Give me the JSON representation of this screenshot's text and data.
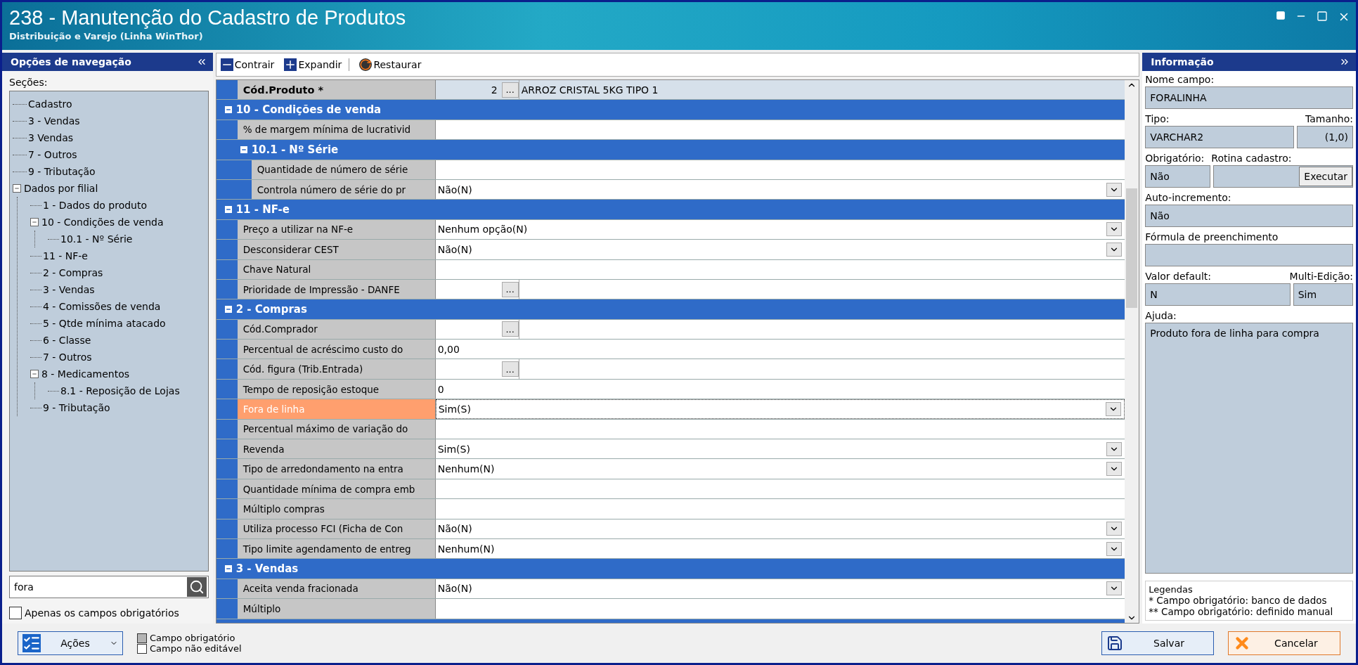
{
  "window": {
    "title": "238 - Manutenção do Cadastro de Produtos",
    "subtitle": "Distribuição e Varejo (Linha WinThor)"
  },
  "navigation": {
    "title": "Opções de navegação",
    "sections_label": "Seções:",
    "tree": [
      {
        "label": "Cadastro"
      },
      {
        "label": "3 - Vendas"
      },
      {
        "label": "3 Vendas"
      },
      {
        "label": "7 - Outros"
      },
      {
        "label": "9 - Tributação"
      },
      {
        "label": "Dados por filial",
        "expanded": true,
        "children": [
          {
            "label": "1 - Dados do produto"
          },
          {
            "label": "10 - Condições de venda",
            "expanded": true,
            "children": [
              {
                "label": "10.1 - Nº Série"
              }
            ]
          },
          {
            "label": "11 - NF-e"
          },
          {
            "label": "2 - Compras"
          },
          {
            "label": "3 - Vendas"
          },
          {
            "label": "4 - Comissões de venda"
          },
          {
            "label": "5 - Qtde mínima atacado"
          },
          {
            "label": "6 - Classe"
          },
          {
            "label": "7 - Outros"
          },
          {
            "label": "8 - Medicamentos",
            "expanded": true,
            "children": [
              {
                "label": "8.1 -  Reposição de Lojas"
              }
            ]
          },
          {
            "label": "9 - Tributação"
          }
        ]
      }
    ],
    "search_value": "fora",
    "required_only": {
      "label": "Apenas os campos obrigatórios",
      "checked": false
    }
  },
  "toolbar": [
    {
      "kind": "collapse",
      "label": "Contrair"
    },
    {
      "kind": "expand",
      "label": "Expandir"
    },
    {
      "kind": "restore",
      "label": "Restaurar"
    }
  ],
  "product": {
    "label": "Cód.Produto *",
    "code": "2",
    "lookup": "...",
    "description": "ARROZ CRISTAL 5KG TIPO 1"
  },
  "sections": [
    {
      "title": "10 - Condições de venda",
      "expanded": true,
      "fields": [
        {
          "label": "% de margem mínima de lucrativid",
          "kind": "text",
          "selected": false
        }
      ],
      "sections": [
        {
          "title": "10.1 - Nº Série",
          "expanded": true,
          "fields": [
            {
              "label": "Quantidade de número de série",
              "kind": "text",
              "selected": false
            },
            {
              "label": "Controla número de série do pr",
              "kind": "dropdown",
              "value": "Não(N)",
              "selected": false
            }
          ]
        }
      ]
    },
    {
      "title": "11 - NF-e",
      "expanded": true,
      "fields": [
        {
          "label": "Preço a utilizar na NF-e",
          "kind": "dropdown",
          "value": "Nenhum opção(N)",
          "selected": false
        },
        {
          "label": "Desconsiderar CEST",
          "kind": "dropdown",
          "value": "Não(N)",
          "selected": false
        },
        {
          "label": "Chave Natural",
          "kind": "text",
          "selected": false
        },
        {
          "label": "Prioridade de Impressão - DANFE",
          "kind": "lookup",
          "lookup": "...",
          "selected": false
        }
      ]
    },
    {
      "title": "2 - Compras",
      "expanded": true,
      "fields": [
        {
          "label": "Cód.Comprador",
          "kind": "lookup",
          "lookup": "...",
          "selected": false
        },
        {
          "label": "Percentual de acréscimo custo do",
          "kind": "text",
          "value": "0,00",
          "selected": false
        },
        {
          "label": "Cód. figura (Trib.Entrada)",
          "kind": "lookup",
          "lookup": "...",
          "selected": false
        },
        {
          "label": "Tempo de reposição estoque",
          "kind": "text",
          "value": "0",
          "selected": false
        },
        {
          "label": "Fora de linha",
          "kind": "dropdown",
          "value": "Sim(S)",
          "selected": true
        },
        {
          "label": "Percentual máximo de variação do",
          "kind": "text",
          "selected": false
        },
        {
          "label": "Revenda",
          "kind": "dropdown",
          "value": "Sim(S)",
          "selected": false
        },
        {
          "label": "Tipo de arredondamento na entra",
          "kind": "dropdown",
          "value": "Nenhum(N)",
          "selected": false
        },
        {
          "label": "Quantidade mínima de compra emb",
          "kind": "text",
          "selected": false
        },
        {
          "label": "Múltiplo compras",
          "kind": "text",
          "selected": false
        },
        {
          "label": "Utiliza processo FCI (Ficha de Con",
          "kind": "dropdown",
          "value": "Não(N)",
          "selected": false
        },
        {
          "label": "Tipo limite agendamento de entreg",
          "kind": "dropdown",
          "value": "Nenhum(N)",
          "selected": false
        }
      ]
    },
    {
      "title": "3 - Vendas",
      "expanded": true,
      "fields": [
        {
          "label": "Aceita venda fracionada",
          "kind": "dropdown",
          "value": "Não(N)",
          "selected": false
        },
        {
          "label": "Múltiplo",
          "kind": "text",
          "selected": false
        }
      ]
    }
  ],
  "info": {
    "title": "Informação",
    "field_name": {
      "label": "Nome campo:",
      "value": "FORALINHA"
    },
    "type": {
      "label": "Tipo:",
      "value": "VARCHAR2"
    },
    "size": {
      "label": "Tamanho:",
      "value": "(1,0)"
    },
    "required": {
      "label": "Obrigatório:",
      "value": "Não"
    },
    "routine": {
      "label": "Rotina cadastro:",
      "button": "Executar"
    },
    "auto_increment": {
      "label": "Auto-incremento:",
      "value": "Não"
    },
    "formula": {
      "label": "Fórmula de preenchimento"
    },
    "default": {
      "label": "Valor default:",
      "value": "N"
    },
    "multi_edit": {
      "label": "Multi-Edição:",
      "value": "Sim"
    },
    "help": {
      "label": "Ajuda:",
      "value": "Produto fora de linha para compra"
    },
    "legend": {
      "title": "Legendas",
      "lines": [
        "* Campo obrigatório: banco de dados",
        "** Campo obrigatório: definido manual"
      ]
    }
  },
  "footer": {
    "actions": "Ações",
    "legend": [
      {
        "label": "Campo obrigatório",
        "color": "#b4b4b4"
      },
      {
        "label": "Campo não editável",
        "color": "#ffffff"
      }
    ],
    "save": "Salvar",
    "cancel": "Cancelar"
  }
}
